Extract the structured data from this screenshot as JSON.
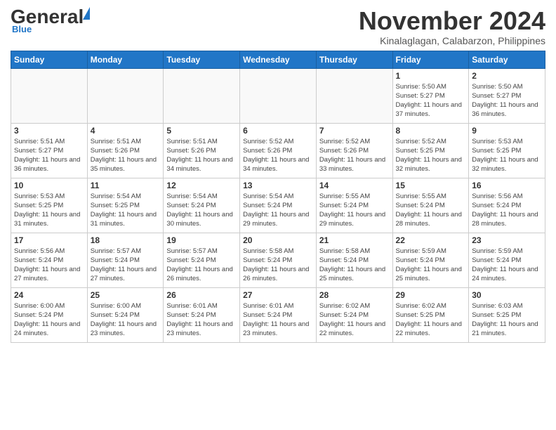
{
  "header": {
    "logo_general": "General",
    "logo_blue": "Blue",
    "month_year": "November 2024",
    "location": "Kinalaglagan, Calabarzon, Philippines"
  },
  "weekdays": [
    "Sunday",
    "Monday",
    "Tuesday",
    "Wednesday",
    "Thursday",
    "Friday",
    "Saturday"
  ],
  "weeks": [
    [
      {
        "day": "",
        "info": ""
      },
      {
        "day": "",
        "info": ""
      },
      {
        "day": "",
        "info": ""
      },
      {
        "day": "",
        "info": ""
      },
      {
        "day": "",
        "info": ""
      },
      {
        "day": "1",
        "info": "Sunrise: 5:50 AM\nSunset: 5:27 PM\nDaylight: 11 hours and 37 minutes."
      },
      {
        "day": "2",
        "info": "Sunrise: 5:50 AM\nSunset: 5:27 PM\nDaylight: 11 hours and 36 minutes."
      }
    ],
    [
      {
        "day": "3",
        "info": "Sunrise: 5:51 AM\nSunset: 5:27 PM\nDaylight: 11 hours and 36 minutes."
      },
      {
        "day": "4",
        "info": "Sunrise: 5:51 AM\nSunset: 5:26 PM\nDaylight: 11 hours and 35 minutes."
      },
      {
        "day": "5",
        "info": "Sunrise: 5:51 AM\nSunset: 5:26 PM\nDaylight: 11 hours and 34 minutes."
      },
      {
        "day": "6",
        "info": "Sunrise: 5:52 AM\nSunset: 5:26 PM\nDaylight: 11 hours and 34 minutes."
      },
      {
        "day": "7",
        "info": "Sunrise: 5:52 AM\nSunset: 5:26 PM\nDaylight: 11 hours and 33 minutes."
      },
      {
        "day": "8",
        "info": "Sunrise: 5:52 AM\nSunset: 5:25 PM\nDaylight: 11 hours and 32 minutes."
      },
      {
        "day": "9",
        "info": "Sunrise: 5:53 AM\nSunset: 5:25 PM\nDaylight: 11 hours and 32 minutes."
      }
    ],
    [
      {
        "day": "10",
        "info": "Sunrise: 5:53 AM\nSunset: 5:25 PM\nDaylight: 11 hours and 31 minutes."
      },
      {
        "day": "11",
        "info": "Sunrise: 5:54 AM\nSunset: 5:25 PM\nDaylight: 11 hours and 31 minutes."
      },
      {
        "day": "12",
        "info": "Sunrise: 5:54 AM\nSunset: 5:24 PM\nDaylight: 11 hours and 30 minutes."
      },
      {
        "day": "13",
        "info": "Sunrise: 5:54 AM\nSunset: 5:24 PM\nDaylight: 11 hours and 29 minutes."
      },
      {
        "day": "14",
        "info": "Sunrise: 5:55 AM\nSunset: 5:24 PM\nDaylight: 11 hours and 29 minutes."
      },
      {
        "day": "15",
        "info": "Sunrise: 5:55 AM\nSunset: 5:24 PM\nDaylight: 11 hours and 28 minutes."
      },
      {
        "day": "16",
        "info": "Sunrise: 5:56 AM\nSunset: 5:24 PM\nDaylight: 11 hours and 28 minutes."
      }
    ],
    [
      {
        "day": "17",
        "info": "Sunrise: 5:56 AM\nSunset: 5:24 PM\nDaylight: 11 hours and 27 minutes."
      },
      {
        "day": "18",
        "info": "Sunrise: 5:57 AM\nSunset: 5:24 PM\nDaylight: 11 hours and 27 minutes."
      },
      {
        "day": "19",
        "info": "Sunrise: 5:57 AM\nSunset: 5:24 PM\nDaylight: 11 hours and 26 minutes."
      },
      {
        "day": "20",
        "info": "Sunrise: 5:58 AM\nSunset: 5:24 PM\nDaylight: 11 hours and 26 minutes."
      },
      {
        "day": "21",
        "info": "Sunrise: 5:58 AM\nSunset: 5:24 PM\nDaylight: 11 hours and 25 minutes."
      },
      {
        "day": "22",
        "info": "Sunrise: 5:59 AM\nSunset: 5:24 PM\nDaylight: 11 hours and 25 minutes."
      },
      {
        "day": "23",
        "info": "Sunrise: 5:59 AM\nSunset: 5:24 PM\nDaylight: 11 hours and 24 minutes."
      }
    ],
    [
      {
        "day": "24",
        "info": "Sunrise: 6:00 AM\nSunset: 5:24 PM\nDaylight: 11 hours and 24 minutes."
      },
      {
        "day": "25",
        "info": "Sunrise: 6:00 AM\nSunset: 5:24 PM\nDaylight: 11 hours and 23 minutes."
      },
      {
        "day": "26",
        "info": "Sunrise: 6:01 AM\nSunset: 5:24 PM\nDaylight: 11 hours and 23 minutes."
      },
      {
        "day": "27",
        "info": "Sunrise: 6:01 AM\nSunset: 5:24 PM\nDaylight: 11 hours and 23 minutes."
      },
      {
        "day": "28",
        "info": "Sunrise: 6:02 AM\nSunset: 5:24 PM\nDaylight: 11 hours and 22 minutes."
      },
      {
        "day": "29",
        "info": "Sunrise: 6:02 AM\nSunset: 5:25 PM\nDaylight: 11 hours and 22 minutes."
      },
      {
        "day": "30",
        "info": "Sunrise: 6:03 AM\nSunset: 5:25 PM\nDaylight: 11 hours and 21 minutes."
      }
    ]
  ]
}
